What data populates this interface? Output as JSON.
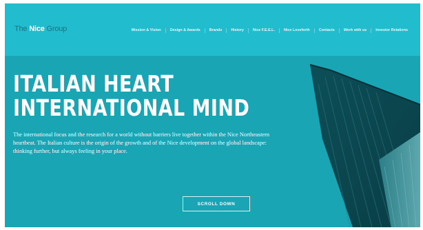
{
  "header": {
    "logo": {
      "prefix": "The ",
      "strong": "Nice",
      "suffix": " Group"
    },
    "nav": [
      {
        "label": "Mission & Vision"
      },
      {
        "label": "Design & Awards"
      },
      {
        "label": "Brands"
      },
      {
        "label": "History"
      },
      {
        "label": "Nice F.E.E.L."
      },
      {
        "label": "Nice Loveforth"
      },
      {
        "label": "Contacts"
      },
      {
        "label": "Work with us"
      },
      {
        "label": "Investor Relations"
      }
    ]
  },
  "hero": {
    "headline_line1": "ITALIAN HEART",
    "headline_line2": "INTERNATIONAL MIND",
    "intro": "The international focus and the research for a world without barriers live together within the Nice Northeastern heartbeat. The Italian culture is the origin of the growth and of the Nice development on the global landscape: thinking further, but always feeling in your place.",
    "scroll_label": "SCROLL DOWN"
  },
  "colors": {
    "header_bg": "#21bcce",
    "hero_bg": "#1aa5b5",
    "text": "#ffffff"
  }
}
